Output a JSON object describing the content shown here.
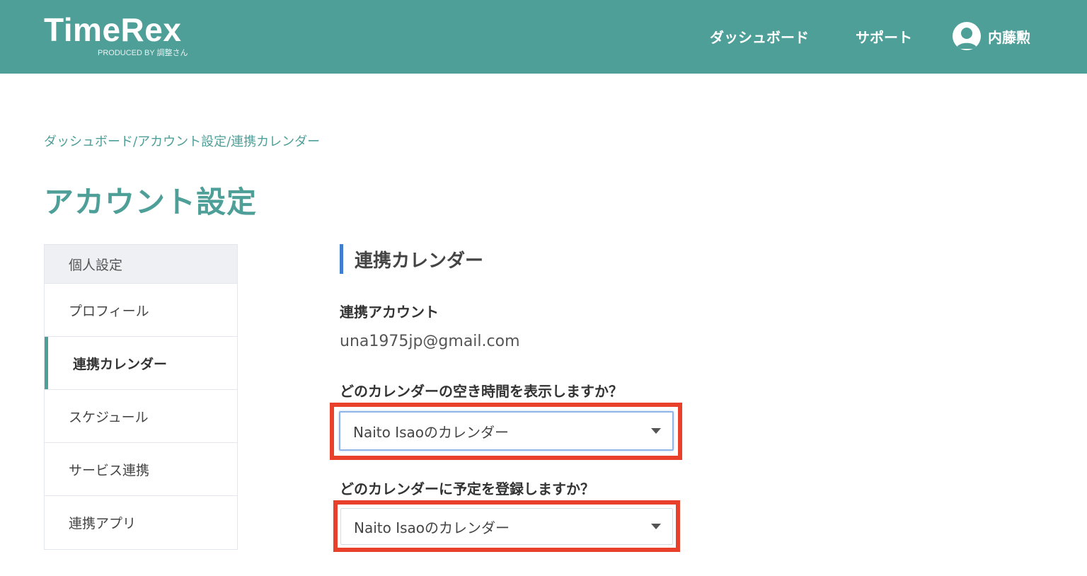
{
  "header": {
    "logo": "TimeRex",
    "logo_sub": "PRODUCED BY 調整さん",
    "nav": {
      "dashboard": "ダッシュボード",
      "support": "サポート",
      "user_name": "内藤勲"
    }
  },
  "breadcrumb": {
    "items": [
      "ダッシュボード",
      "アカウント設定",
      "連携カレンダー"
    ],
    "separator": "/"
  },
  "page_title": "アカウント設定",
  "sidebar": {
    "heading": "個人設定",
    "items": [
      {
        "label": "プロフィール"
      },
      {
        "label": "連携カレンダー",
        "active": true
      },
      {
        "label": "スケジュール"
      },
      {
        "label": "サービス連携"
      },
      {
        "label": "連携アプリ"
      }
    ]
  },
  "main": {
    "section_title": "連携カレンダー",
    "account_label": "連携アカウント",
    "account_email": "una1975jp@gmail.com",
    "availability_question": "どのカレンダーの空き時間を表示しますか？",
    "availability_selected": "Naito Isaoのカレンダー",
    "register_question": "どのカレンダーに予定を登録しますか？",
    "register_selected": "Naito Isaoのカレンダー"
  },
  "colors": {
    "header_bg": "#4f9f99",
    "accent": "#4f9f99",
    "section_bar": "#3f7fd0",
    "highlight": "#e8402a"
  }
}
